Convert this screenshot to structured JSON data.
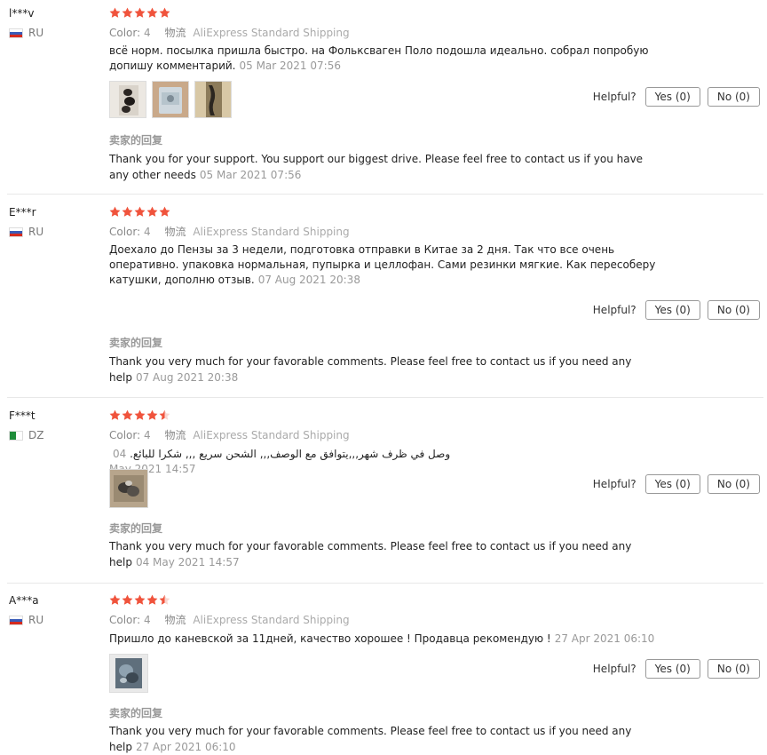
{
  "colors": {
    "star": "#f0533c",
    "divider": "#e8e8e8",
    "muted": "#999999"
  },
  "labels": {
    "color": "Color:",
    "shipping": "物流",
    "seller_reply": "卖家的回复",
    "helpful": "Helpful?"
  },
  "reviews": [
    {
      "user": "l***v",
      "country": "RU",
      "flag": "flag-ru",
      "stars": 5,
      "color_value": "4",
      "shipping_value": "AliExpress Standard Shipping",
      "text": "всё норм. посылка пришла быстро. на Фольксваген Поло подошла идеально. собрал попробую допишу комментарий.",
      "date": "05 Mar 2021 07:56",
      "photo_icons": [
        "photo-icon",
        "photo-icon",
        "photo-icon"
      ],
      "reply": "Thank you for your support. You support our biggest drive. Please feel free to contact us if you have any other needs",
      "reply_date": "05 Mar 2021 07:56",
      "yes": "Yes (0)",
      "no": "No (0)"
    },
    {
      "user": "E***r",
      "country": "RU",
      "flag": "flag-ru",
      "stars": 5,
      "color_value": "4",
      "shipping_value": "AliExpress Standard Shipping",
      "text": "Доехало до Пензы за 3 недели, подготовка отправки в Китае за 2 дня. Так что все очень оперативно. упаковка нормальная, пупырка и целлофан. Сами резинки мягкие. Как пересоберу катушки, дополню отзыв.",
      "date": "07 Aug 2021 20:38",
      "photo_icons": [],
      "reply": "Thank you very much for your favorable comments. Please feel free to contact us if you need any help",
      "reply_date": "07 Aug 2021 20:38",
      "yes": "Yes (0)",
      "no": "No (0)"
    },
    {
      "user": "F***t",
      "country": "DZ",
      "flag": "flag-dz",
      "stars": 4.5,
      "color_value": "4",
      "shipping_value": "AliExpress Standard Shipping",
      "text": "وصل في ظرف شهر,,,يتوافق مع الوصف,,, الشحن سريع ,,, شكرا للبائع.",
      "date": "04 May 2021 14:57",
      "photo_icons": [
        "photo-icon"
      ],
      "reply": "Thank you very much for your favorable comments. Please feel free to contact us if you need any help",
      "reply_date": "04 May 2021 14:57",
      "yes": "Yes (0)",
      "no": "No (0)"
    },
    {
      "user": "A***a",
      "country": "RU",
      "flag": "flag-ru",
      "stars": 4.5,
      "color_value": "4",
      "shipping_value": "AliExpress Standard Shipping",
      "text": "Пришло до каневской за 11дней, качество хорошее ! Продавца рекомендую !",
      "date": "27 Apr 2021 06:10",
      "photo_icons": [
        "photo-icon"
      ],
      "reply": "Thank you very much for your favorable comments. Please feel free to contact us if you need any help",
      "reply_date": "27 Apr 2021 06:10",
      "yes": "Yes (0)",
      "no": "No (0)"
    }
  ]
}
